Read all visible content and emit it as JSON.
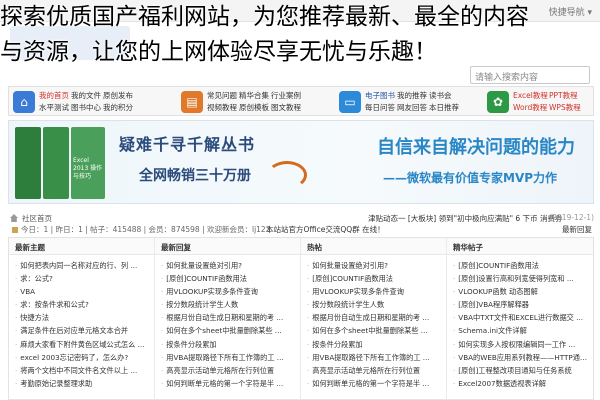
{
  "caption": {
    "line1": "探索优质国产福利网站，为您推荐最新、最全的内容",
    "line2": "与资源，让您的上网体验尽享无忧与乐趣！"
  },
  "header": {
    "right_text": "快捷导航 ▾",
    "search_placeholder": "请输入搜索内容"
  },
  "nav": {
    "groups": [
      {
        "icon": "home-icon",
        "color": "#3a7bd5",
        "rows": [
          [
            "我的首页",
            "我的文件",
            "原创发布"
          ],
          [
            "水平测试",
            "图书中心",
            "我的积分"
          ]
        ]
      },
      {
        "icon": "book-icon",
        "color": "#e07a2a",
        "rows": [
          [
            "常见问题",
            "精华合集",
            "行业案例"
          ],
          [
            "视频教程",
            "原创模板",
            "图文教程"
          ]
        ]
      },
      {
        "icon": "monitor-icon",
        "color": "#2c8ad8",
        "rows": [
          [
            "电子图书",
            "我的推荐",
            "读书会"
          ],
          [
            "每日问答",
            "网友回答",
            "本日推荐"
          ]
        ]
      },
      {
        "icon": "office-icon",
        "color": "#2c9a45",
        "rows": [
          [
            "Excel教程",
            "PPT教程"
          ],
          [
            "Word教程",
            "WPS教程"
          ]
        ]
      }
    ]
  },
  "banner": {
    "left_title": "疑难千寻千解丛书",
    "left_sub": "全网畅销三十万册",
    "right_title": "自信来自解决问题的能力",
    "right_sub": "——微软最有价值专家MVP力作",
    "book_label": "Excel 2013 操作与技巧"
  },
  "breadcrumb": {
    "path": "社区首页",
    "news": "津贴动态一 [大板块] 领到\"初中极向应满贴\" 6 下币 消费券",
    "date": "(2019-12-1)"
  },
  "stats": {
    "left": "今日：1 | 昨日：1 | 帖子：415488 | 会员：874598 | 欢迎新会员：lj123",
    "mid": "本站站官方Office交流QQ群 在线！",
    "right": "最新回复"
  },
  "columns": [
    {
      "title": "最新主题",
      "items": [
        "如何把表内同一名称对应的行、列 ...",
        "求：公式?",
        "VBA",
        "求：按条件求和公式?",
        "快捷方法",
        "满足条件在后对应单元格文本合并",
        "麻烦大家看下附件黄色区域公式怎么 ...",
        "excel 2003忘记密码了，怎么办?",
        "将两个文档中不同文件名文件以上 ...",
        "考勤原始记录整理求助"
      ]
    },
    {
      "title": "最新回复",
      "items": [
        "如何批量设置绝对引用?",
        "[原创]COUNTIF函数用法",
        "用VLOOKUP实现多条件查询",
        "按分数段统计学生人数",
        "根据月份自动生成日期和星期的考 ...",
        "如何在多个sheet中批量删除某些 ...",
        "按条件分段累加",
        "用VBA提取路径下所有工作簿的工 ...",
        "高亮显示活动单元格所在行列位置",
        "如何判断单元格的第一个字符是半 ..."
      ]
    },
    {
      "title": "热帖",
      "items": [
        "如何批量设置绝对引用?",
        "[原创]COUNTIF函数用法",
        "用VLOOKUP实现多条件查询",
        "按分数段统计学生人数",
        "根据月份自动生成日期和星期的考 ...",
        "如何在多个sheet中批量删除某些 ...",
        "按条件分段累加",
        "用VBA提取路径下所有工作簿的工 ...",
        "高亮显示活动单元格所在行列位置",
        "如何判断单元格的第一个字符是半 ..."
      ]
    },
    {
      "title": "精华帖子",
      "items": [
        "[原创]COUNTIF函数用法",
        "[原创]设置行高和列宽使得列宽和 ...",
        "VLOOKUP函数 动态图解",
        "[原创]VBA程序解释器",
        "VBA中TXT文件和EXCEL进行数据交 ...",
        "Schema.ini文件详解",
        "如何实现多人按权限编辑同一工作 ...",
        "VBA的WEB应用系列教程——HTTP通 ...",
        "[原创]工程整改项目通知与任务系统",
        "Excel2007数据透视表详解"
      ]
    }
  ]
}
